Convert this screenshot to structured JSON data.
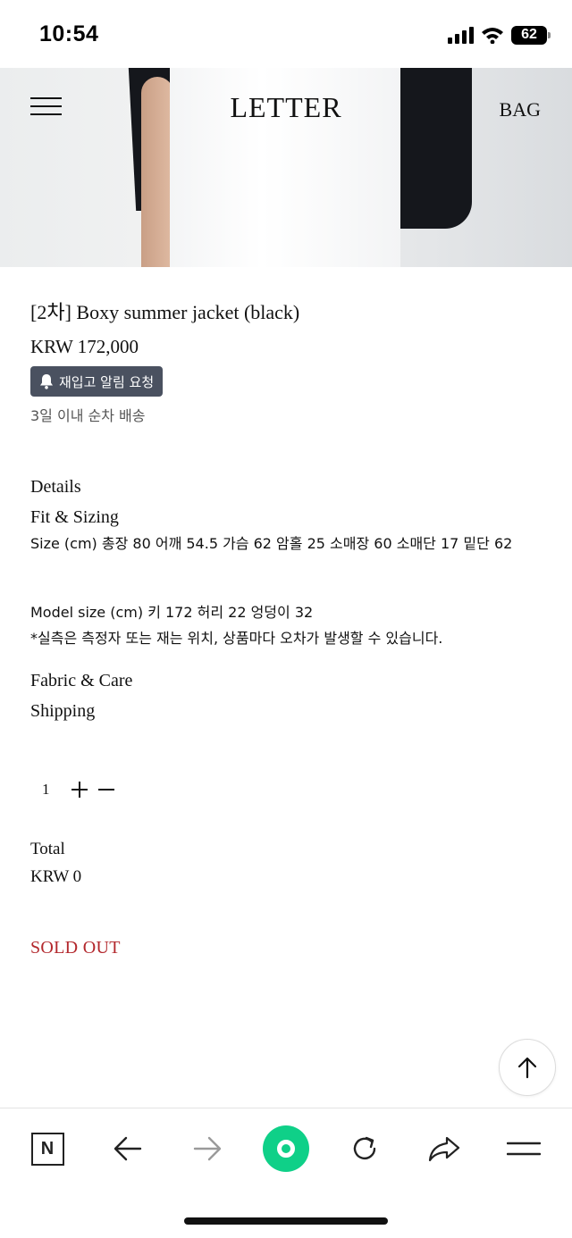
{
  "status_bar": {
    "time": "10:54",
    "battery": "62"
  },
  "header": {
    "logo": "LETTER",
    "bag_label": "BAG"
  },
  "product": {
    "title": "[2차] Boxy summer jacket (black)",
    "price": "KRW 172,000",
    "restock_label": "재입고 알림 요청",
    "shipping_note": "3일 이내 순차 배송"
  },
  "details": {
    "heading": "Details",
    "fit_heading": "Fit & Sizing",
    "size_text": "Size (cm) 총장 80 어깨 54.5 가슴 62 암홀 25 소매장 60 소매단 17 밑단 62",
    "model_text": "Model size (cm) 키 172 허리 22 엉덩이 32",
    "note_text": "*실측은 측정자 또는 재는 위치, 상품마다 오차가 발생할 수 있습니다.",
    "fabric_heading": "Fabric & Care",
    "shipping_heading": "Shipping"
  },
  "quantity": {
    "value": "1"
  },
  "total": {
    "label": "Total",
    "value": "KRW 0"
  },
  "sold_out_label": "SOLD OUT",
  "colors": {
    "sold_out": "#b3282d",
    "restock_bg": "#4a5160",
    "browser_green": "#0fd088"
  },
  "toolbar_icons": [
    "naver-icon",
    "back-arrow-icon",
    "forward-arrow-icon",
    "green-dot-icon",
    "refresh-icon",
    "share-icon",
    "menu-icon"
  ]
}
